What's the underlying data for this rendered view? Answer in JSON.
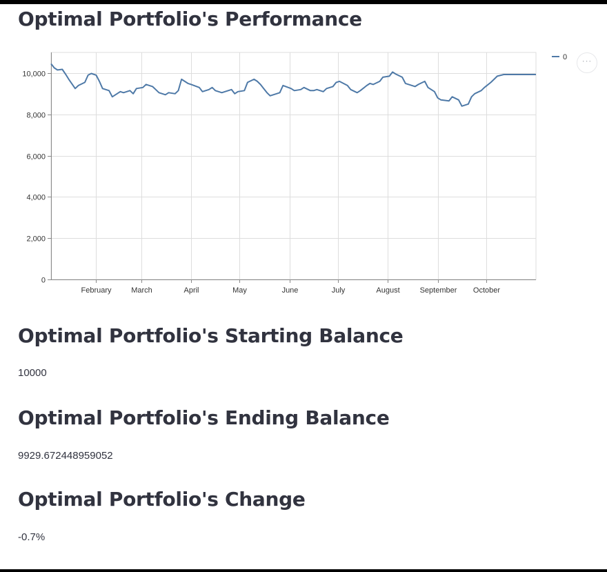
{
  "sections": {
    "performance_title": "Optimal Portfolio's Performance",
    "starting_title": "Optimal Portfolio's Starting Balance",
    "starting_value": "10000",
    "ending_title": "Optimal Portfolio's Ending Balance",
    "ending_value": "9929.672448959052",
    "change_title": "Optimal Portfolio's Change",
    "change_value": "-0.7%"
  },
  "chart_menu_icon": "ellipsis-icon",
  "chart_data": {
    "type": "line",
    "title": "",
    "xlabel": "",
    "ylabel": "",
    "ylim": [
      0,
      11000
    ],
    "yticks": [
      0,
      2000,
      4000,
      6000,
      8000,
      10000
    ],
    "ytick_labels": [
      "0",
      "2,000",
      "4,000",
      "6,000",
      "8,000",
      "10,000"
    ],
    "xlim": [
      "2021-01-04",
      "2021-11-01"
    ],
    "xticks": [
      "2021-02-01",
      "2021-03-01",
      "2021-04-01",
      "2021-05-01",
      "2021-06-01",
      "2021-07-01",
      "2021-08-01",
      "2021-09-01",
      "2021-10-01"
    ],
    "xtick_labels": [
      "February",
      "March",
      "April",
      "May",
      "June",
      "July",
      "August",
      "September",
      "October"
    ],
    "grid": true,
    "legend_position": "top-right",
    "series": [
      {
        "name": "0",
        "color": "#4e79a7",
        "x": [
          "2021-01-04",
          "2021-01-06",
          "2021-01-08",
          "2021-01-11",
          "2021-01-13",
          "2021-01-15",
          "2021-01-19",
          "2021-01-21",
          "2021-01-25",
          "2021-01-27",
          "2021-01-29",
          "2021-02-01",
          "2021-02-03",
          "2021-02-05",
          "2021-02-09",
          "2021-02-11",
          "2021-02-16",
          "2021-02-18",
          "2021-02-22",
          "2021-02-24",
          "2021-02-26",
          "2021-03-02",
          "2021-03-04",
          "2021-03-08",
          "2021-03-10",
          "2021-03-12",
          "2021-03-16",
          "2021-03-18",
          "2021-03-22",
          "2021-03-24",
          "2021-03-26",
          "2021-03-30",
          "2021-04-01",
          "2021-04-06",
          "2021-04-08",
          "2021-04-12",
          "2021-04-14",
          "2021-04-16",
          "2021-04-20",
          "2021-04-22",
          "2021-04-26",
          "2021-04-28",
          "2021-04-30",
          "2021-05-04",
          "2021-05-06",
          "2021-05-10",
          "2021-05-12",
          "2021-05-14",
          "2021-05-18",
          "2021-05-20",
          "2021-05-24",
          "2021-05-26",
          "2021-05-28",
          "2021-06-02",
          "2021-06-04",
          "2021-06-08",
          "2021-06-10",
          "2021-06-14",
          "2021-06-16",
          "2021-06-18",
          "2021-06-22",
          "2021-06-24",
          "2021-06-28",
          "2021-06-30",
          "2021-07-02",
          "2021-07-07",
          "2021-07-09",
          "2021-07-13",
          "2021-07-15",
          "2021-07-19",
          "2021-07-21",
          "2021-07-23",
          "2021-07-27",
          "2021-07-29",
          "2021-08-02",
          "2021-08-04",
          "2021-08-06",
          "2021-08-10",
          "2021-08-12",
          "2021-08-16",
          "2021-08-18",
          "2021-08-20",
          "2021-08-24",
          "2021-08-26",
          "2021-08-30",
          "2021-09-01",
          "2021-09-03",
          "2021-09-08",
          "2021-09-10",
          "2021-09-14",
          "2021-09-16",
          "2021-09-20",
          "2021-09-22",
          "2021-09-24",
          "2021-09-28",
          "2021-09-30",
          "2021-10-04",
          "2021-10-06",
          "2021-10-08",
          "2021-10-12",
          "2021-10-14",
          "2021-10-18",
          "2021-10-20",
          "2021-10-22",
          "2021-10-26",
          "2021-10-28",
          "2021-11-01"
        ],
        "y": [
          10450,
          10250,
          10150,
          10180,
          9950,
          9700,
          9250,
          9400,
          9550,
          9900,
          9980,
          9900,
          9600,
          9250,
          9150,
          8850,
          9100,
          9050,
          9150,
          9000,
          9250,
          9300,
          9450,
          9350,
          9200,
          9050,
          8950,
          9050,
          9000,
          9150,
          9700,
          9500,
          9450,
          9300,
          9100,
          9200,
          9300,
          9150,
          9050,
          9100,
          9200,
          9000,
          9100,
          9150,
          9550,
          9700,
          9600,
          9450,
          9050,
          8900,
          9000,
          9050,
          9400,
          9250,
          9150,
          9200,
          9300,
          9150,
          9150,
          9200,
          9100,
          9250,
          9350,
          9550,
          9600,
          9400,
          9200,
          9050,
          9150,
          9400,
          9500,
          9450,
          9600,
          9800,
          9850,
          10050,
          9950,
          9800,
          9500,
          9400,
          9350,
          9450,
          9600,
          9300,
          9100,
          8800,
          8700,
          8650,
          8850,
          8700,
          8400,
          8500,
          8850,
          9000,
          9150,
          9300,
          9550,
          9700,
          9850,
          9929.67,
          9929.67,
          9929.67,
          9929.67,
          9929.67,
          9929.67,
          9929.67,
          9929.67
        ]
      }
    ]
  }
}
